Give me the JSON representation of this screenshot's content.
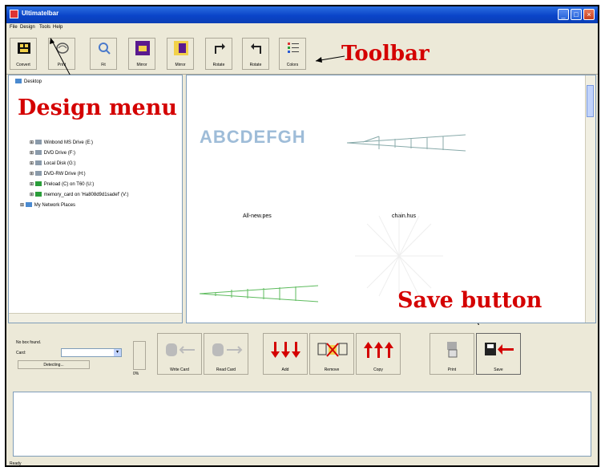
{
  "window": {
    "title": "Ultimatelbar"
  },
  "menu": [
    "File",
    "Design",
    "Tools",
    "Help"
  ],
  "toolbar": {
    "buttons": [
      {
        "label": "Convert",
        "icon": "convert-icon"
      },
      {
        "label": "Print",
        "icon": "print-icon"
      },
      {
        "label": "Fit",
        "icon": "fit-icon"
      },
      {
        "label": "Mirror",
        "icon": "mirror-horizontal-icon"
      },
      {
        "label": "Mirror",
        "icon": "mirror-vertical-icon"
      },
      {
        "label": "Rotate",
        "icon": "rotate-right-icon"
      },
      {
        "label": "Rotate",
        "icon": "rotate-left-icon"
      },
      {
        "label": "Colors",
        "icon": "colors-icon"
      }
    ]
  },
  "callouts": {
    "toolbar": "Toolbar",
    "design_menu": "Design menu",
    "save_button": "Save button"
  },
  "tree": {
    "root": "Desktop",
    "items": [
      "Winbond MS Drive (E:)",
      "DVD Drive (F:)",
      "Local Disk (G:)",
      "DVD-RW Drive (H:)",
      "Preload (C) on T60 (U:)",
      "memory_card on 'Ha808d9d1sadef' (V:)",
      "My Network Places"
    ]
  },
  "preview": {
    "sample_text": "ABCDEFGH",
    "file1": "All-new.pes",
    "file2": "chain.hus"
  },
  "card_panel": {
    "status": "No box found.",
    "card_label": "Card:",
    "detect_button": "Detecting...",
    "progress": "0%"
  },
  "actions": {
    "write": "Write Card",
    "read": "Read Card",
    "add": "Add",
    "remove": "Remove",
    "copy": "Copy",
    "print": "Print",
    "save": "Save"
  },
  "status": "Ready"
}
